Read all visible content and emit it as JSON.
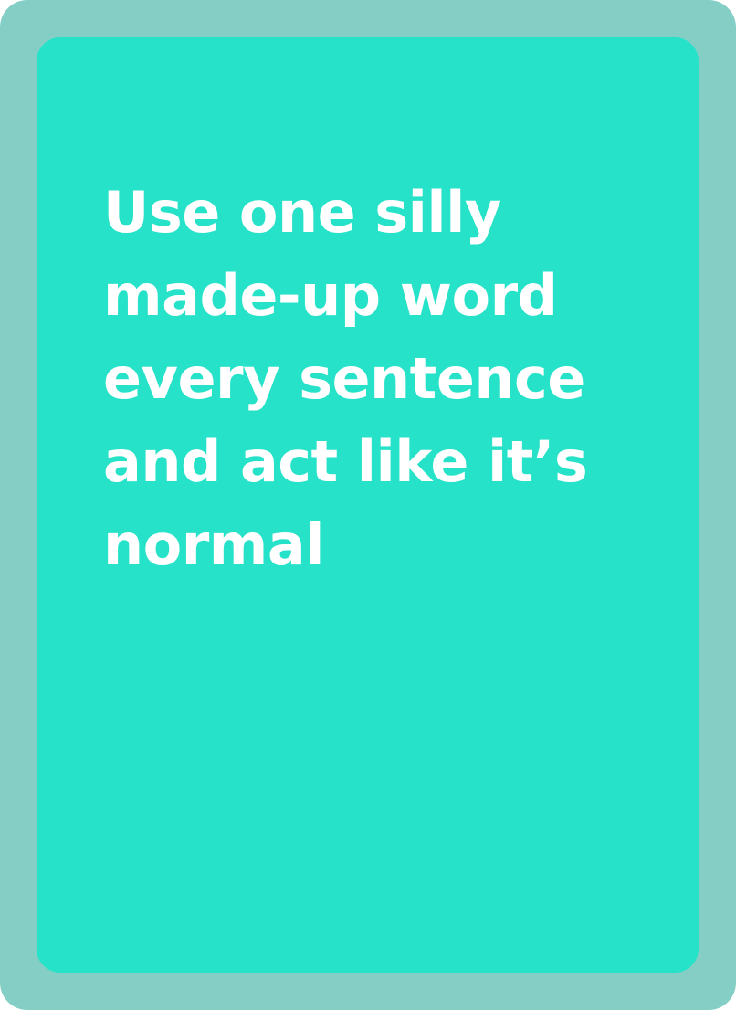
{
  "card": {
    "colors": {
      "frame": "#85cec5",
      "face": "#26e2c8",
      "text": "#ffffff"
    },
    "prompt_lines": [
      "Use one silly",
      "made-up word",
      "every sentence",
      "and act like it’s",
      "normal"
    ]
  }
}
